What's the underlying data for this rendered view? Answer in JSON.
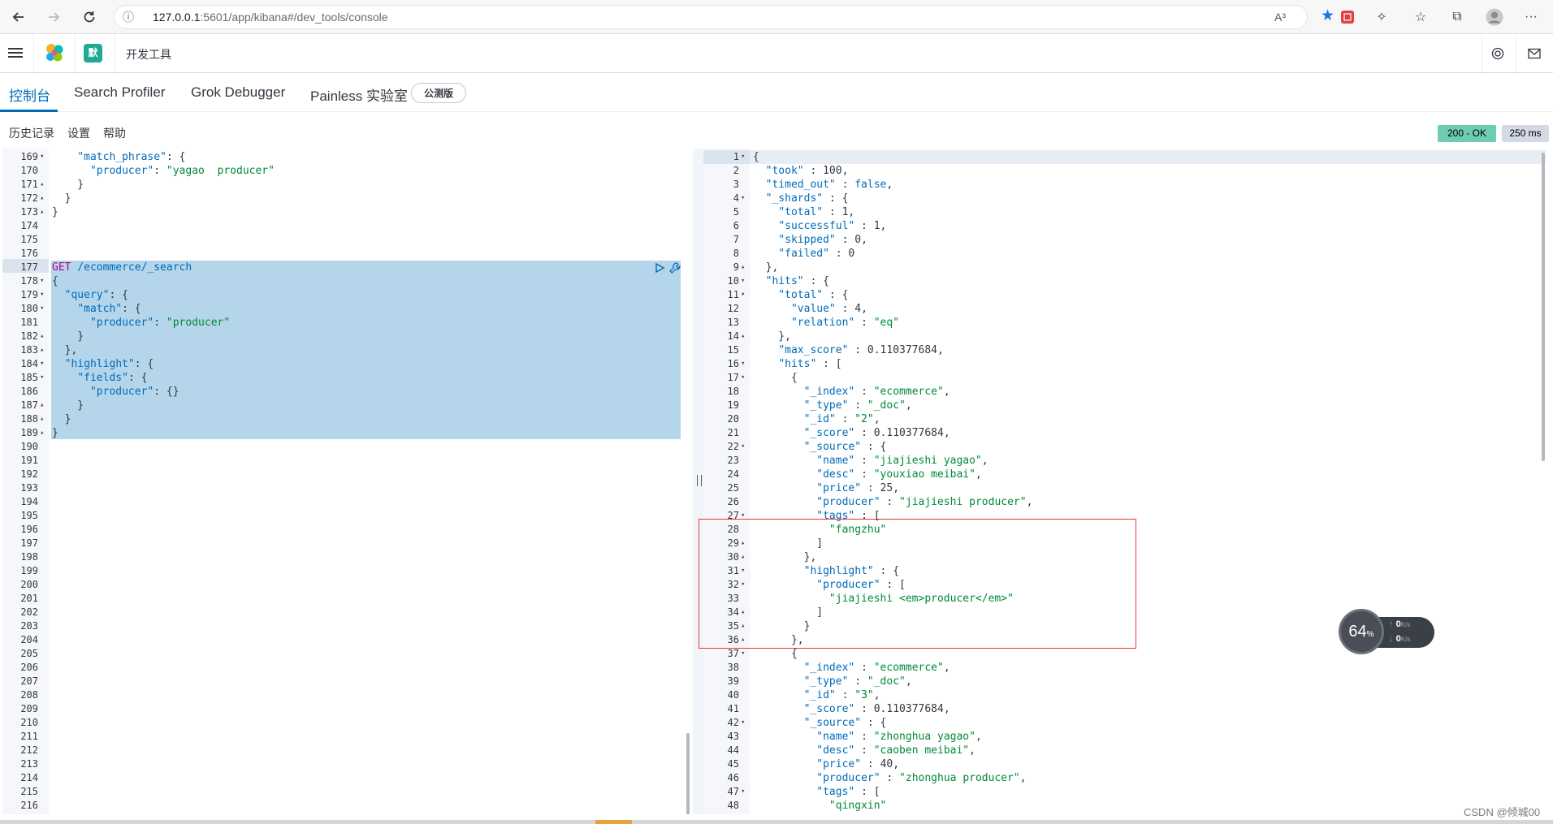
{
  "browser": {
    "url_host": "127.0.0.1",
    "url_path": ":5601/app/kibana#/dev_tools/console",
    "read_aloud": "A³"
  },
  "header": {
    "space_initial": "默",
    "breadcrumb": "开发工具"
  },
  "tabs": [
    {
      "label": "控制台"
    },
    {
      "label": "Search Profiler"
    },
    {
      "label": "Grok Debugger"
    },
    {
      "label": "Painless 实验室"
    }
  ],
  "beta_badge": "公测版",
  "menu": {
    "history": "历史记录",
    "settings": "设置",
    "help": "帮助"
  },
  "status": {
    "code": "200 - OK",
    "time": "250 ms"
  },
  "request_lines": [
    {
      "n": "169",
      "f": "▾",
      "t": "    \"match_phrase\": {"
    },
    {
      "n": "170",
      "f": "",
      "t": "      \"producer\": \"yagao  producer\""
    },
    {
      "n": "171",
      "f": "▴",
      "t": "    }"
    },
    {
      "n": "172",
      "f": "▴",
      "t": "  }"
    },
    {
      "n": "173",
      "f": "▴",
      "t": "}"
    },
    {
      "n": "174",
      "f": "",
      "t": ""
    },
    {
      "n": "175",
      "f": "",
      "t": ""
    },
    {
      "n": "176",
      "f": "",
      "t": ""
    },
    {
      "n": "177",
      "f": "",
      "t": "GET /ecommerce/_search"
    },
    {
      "n": "178",
      "f": "▾",
      "t": "{"
    },
    {
      "n": "179",
      "f": "▾",
      "t": "  \"query\": {"
    },
    {
      "n": "180",
      "f": "▾",
      "t": "    \"match\": {"
    },
    {
      "n": "181",
      "f": "",
      "t": "      \"producer\": \"producer\""
    },
    {
      "n": "182",
      "f": "▴",
      "t": "    }"
    },
    {
      "n": "183",
      "f": "▴",
      "t": "  },"
    },
    {
      "n": "184",
      "f": "▾",
      "t": "  \"highlight\": {"
    },
    {
      "n": "185",
      "f": "▾",
      "t": "    \"fields\": {"
    },
    {
      "n": "186",
      "f": "",
      "t": "      \"producer\": {}"
    },
    {
      "n": "187",
      "f": "▴",
      "t": "    }"
    },
    {
      "n": "188",
      "f": "▴",
      "t": "  }"
    },
    {
      "n": "189",
      "f": "▴",
      "t": "}"
    },
    {
      "n": "190",
      "f": "",
      "t": ""
    },
    {
      "n": "191",
      "f": "",
      "t": ""
    },
    {
      "n": "192",
      "f": "",
      "t": ""
    },
    {
      "n": "193",
      "f": "",
      "t": ""
    },
    {
      "n": "194",
      "f": "",
      "t": ""
    },
    {
      "n": "195",
      "f": "",
      "t": ""
    },
    {
      "n": "196",
      "f": "",
      "t": ""
    },
    {
      "n": "197",
      "f": "",
      "t": ""
    },
    {
      "n": "198",
      "f": "",
      "t": ""
    },
    {
      "n": "199",
      "f": "",
      "t": ""
    },
    {
      "n": "200",
      "f": "",
      "t": ""
    },
    {
      "n": "201",
      "f": "",
      "t": ""
    },
    {
      "n": "202",
      "f": "",
      "t": ""
    },
    {
      "n": "203",
      "f": "",
      "t": ""
    },
    {
      "n": "204",
      "f": "",
      "t": ""
    },
    {
      "n": "205",
      "f": "",
      "t": ""
    },
    {
      "n": "206",
      "f": "",
      "t": ""
    },
    {
      "n": "207",
      "f": "",
      "t": ""
    },
    {
      "n": "208",
      "f": "",
      "t": ""
    },
    {
      "n": "209",
      "f": "",
      "t": ""
    },
    {
      "n": "210",
      "f": "",
      "t": ""
    },
    {
      "n": "211",
      "f": "",
      "t": ""
    },
    {
      "n": "212",
      "f": "",
      "t": ""
    },
    {
      "n": "213",
      "f": "",
      "t": ""
    },
    {
      "n": "214",
      "f": "",
      "t": ""
    },
    {
      "n": "215",
      "f": "",
      "t": ""
    },
    {
      "n": "216",
      "f": "",
      "t": ""
    }
  ],
  "response_lines": [
    {
      "n": "1",
      "f": "▾",
      "t": "{"
    },
    {
      "n": "2",
      "f": "",
      "t": "  \"took\" : 100,"
    },
    {
      "n": "3",
      "f": "",
      "t": "  \"timed_out\" : false,"
    },
    {
      "n": "4",
      "f": "▾",
      "t": "  \"_shards\" : {"
    },
    {
      "n": "5",
      "f": "",
      "t": "    \"total\" : 1,"
    },
    {
      "n": "6",
      "f": "",
      "t": "    \"successful\" : 1,"
    },
    {
      "n": "7",
      "f": "",
      "t": "    \"skipped\" : 0,"
    },
    {
      "n": "8",
      "f": "",
      "t": "    \"failed\" : 0"
    },
    {
      "n": "9",
      "f": "▴",
      "t": "  },"
    },
    {
      "n": "10",
      "f": "▾",
      "t": "  \"hits\" : {"
    },
    {
      "n": "11",
      "f": "▾",
      "t": "    \"total\" : {"
    },
    {
      "n": "12",
      "f": "",
      "t": "      \"value\" : 4,"
    },
    {
      "n": "13",
      "f": "",
      "t": "      \"relation\" : \"eq\""
    },
    {
      "n": "14",
      "f": "▴",
      "t": "    },"
    },
    {
      "n": "15",
      "f": "",
      "t": "    \"max_score\" : 0.110377684,"
    },
    {
      "n": "16",
      "f": "▾",
      "t": "    \"hits\" : ["
    },
    {
      "n": "17",
      "f": "▾",
      "t": "      {"
    },
    {
      "n": "18",
      "f": "",
      "t": "        \"_index\" : \"ecommerce\","
    },
    {
      "n": "19",
      "f": "",
      "t": "        \"_type\" : \"_doc\","
    },
    {
      "n": "20",
      "f": "",
      "t": "        \"_id\" : \"2\","
    },
    {
      "n": "21",
      "f": "",
      "t": "        \"_score\" : 0.110377684,"
    },
    {
      "n": "22",
      "f": "▾",
      "t": "        \"_source\" : {"
    },
    {
      "n": "23",
      "f": "",
      "t": "          \"name\" : \"jiajieshi yagao\","
    },
    {
      "n": "24",
      "f": "",
      "t": "          \"desc\" : \"youxiao meibai\","
    },
    {
      "n": "25",
      "f": "",
      "t": "          \"price\" : 25,"
    },
    {
      "n": "26",
      "f": "",
      "t": "          \"producer\" : \"jiajieshi producer\","
    },
    {
      "n": "27",
      "f": "▾",
      "t": "          \"tags\" : ["
    },
    {
      "n": "28",
      "f": "",
      "t": "            \"fangzhu\""
    },
    {
      "n": "29",
      "f": "▴",
      "t": "          ]"
    },
    {
      "n": "30",
      "f": "▴",
      "t": "        },"
    },
    {
      "n": "31",
      "f": "▾",
      "t": "        \"highlight\" : {"
    },
    {
      "n": "32",
      "f": "▾",
      "t": "          \"producer\" : ["
    },
    {
      "n": "33",
      "f": "",
      "t": "            \"jiajieshi <em>producer</em>\""
    },
    {
      "n": "34",
      "f": "▴",
      "t": "          ]"
    },
    {
      "n": "35",
      "f": "▴",
      "t": "        }"
    },
    {
      "n": "36",
      "f": "▴",
      "t": "      },"
    },
    {
      "n": "37",
      "f": "▾",
      "t": "      {"
    },
    {
      "n": "38",
      "f": "",
      "t": "        \"_index\" : \"ecommerce\","
    },
    {
      "n": "39",
      "f": "",
      "t": "        \"_type\" : \"_doc\","
    },
    {
      "n": "40",
      "f": "",
      "t": "        \"_id\" : \"3\","
    },
    {
      "n": "41",
      "f": "",
      "t": "        \"_score\" : 0.110377684,"
    },
    {
      "n": "42",
      "f": "▾",
      "t": "        \"_source\" : {"
    },
    {
      "n": "43",
      "f": "",
      "t": "          \"name\" : \"zhonghua yagao\","
    },
    {
      "n": "44",
      "f": "",
      "t": "          \"desc\" : \"caoben meibai\","
    },
    {
      "n": "45",
      "f": "",
      "t": "          \"price\" : 40,"
    },
    {
      "n": "46",
      "f": "",
      "t": "          \"producer\" : \"zhonghua producer\","
    },
    {
      "n": "47",
      "f": "▾",
      "t": "          \"tags\" : ["
    },
    {
      "n": "48",
      "f": "",
      "t": "            \"qingxin\""
    }
  ],
  "network_widget": {
    "percent": "64",
    "percent_unit": "%",
    "up": "0",
    "down": "0",
    "unit": "K/s"
  },
  "watermark": "CSDN @倾城00"
}
